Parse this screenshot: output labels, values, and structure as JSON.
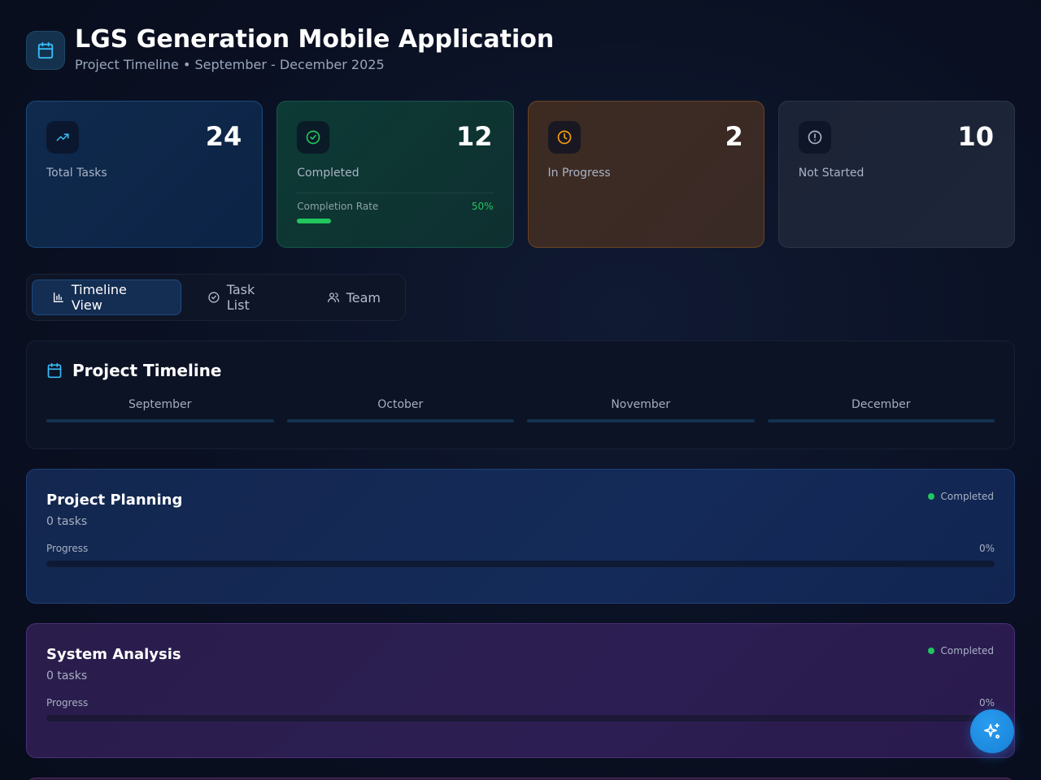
{
  "header": {
    "title": "LGS Generation Mobile Application",
    "subtitle": "Project Timeline • September - December 2025"
  },
  "stats": {
    "total": {
      "value": "24",
      "label": "Total Tasks"
    },
    "completed": {
      "value": "12",
      "label": "Completed",
      "rate_label": "Completion Rate",
      "rate_value": "50%",
      "rate": 0.5
    },
    "in_progress": {
      "value": "2",
      "label": "In Progress"
    },
    "not_started": {
      "value": "10",
      "label": "Not Started"
    }
  },
  "tabs": [
    {
      "label": "Timeline View",
      "active": true
    },
    {
      "label": "Task List",
      "active": false
    },
    {
      "label": "Team",
      "active": false
    }
  ],
  "timeline": {
    "title": "Project Timeline",
    "months": [
      "September",
      "October",
      "November",
      "December"
    ]
  },
  "phases": [
    {
      "name": "Project Planning",
      "tasks": "0 tasks",
      "status": "Completed",
      "progress_label": "Progress",
      "progress_value": "0%",
      "progress": 0
    },
    {
      "name": "System Analysis",
      "tasks": "0 tasks",
      "status": "Completed",
      "progress_label": "Progress",
      "progress_value": "0%",
      "progress": 0
    }
  ],
  "colors": {
    "accent": "#1681d6",
    "success": "#22c55e",
    "warning": "#f59e0b",
    "info": "#38bdf8"
  },
  "icons": {
    "header": "calendar-icon",
    "total": "trending-up-icon",
    "completed": "check-circle-icon",
    "in_progress": "clock-icon",
    "not_started": "alert-circle-icon",
    "fab": "sparkles-icon"
  }
}
